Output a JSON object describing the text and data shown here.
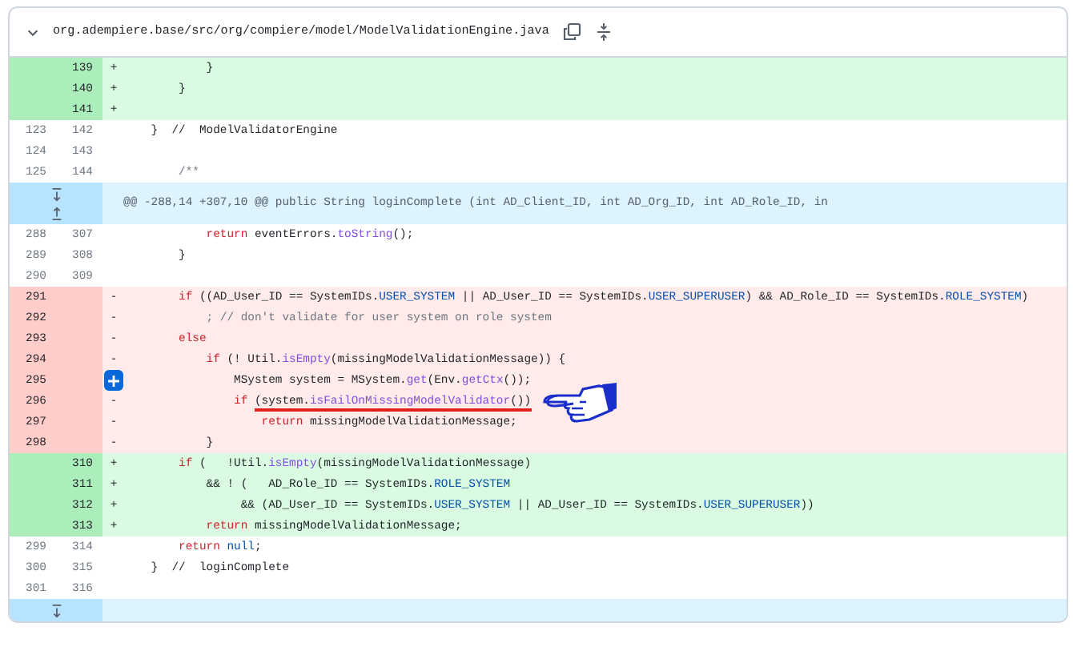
{
  "file": {
    "path": "org.adempiere.base/src/org/compiere/model/ModelValidationEngine.java",
    "expanded": true
  },
  "lines": [
    {
      "kind": "add",
      "new": "139",
      "marker": "+",
      "tokens": [
        {
          "kind": "plain",
          "t": "            }"
        }
      ]
    },
    {
      "kind": "add",
      "new": "140",
      "marker": "+",
      "tokens": [
        {
          "kind": "plain",
          "t": "        }"
        }
      ]
    },
    {
      "kind": "add",
      "new": "141",
      "marker": "+"
    },
    {
      "kind": "context",
      "old": "123",
      "new": "142",
      "tokens": [
        {
          "kind": "plain",
          "t": "    }  //  ModelValidatorEngine"
        }
      ]
    },
    {
      "kind": "context",
      "old": "124",
      "new": "143"
    },
    {
      "kind": "context",
      "old": "125",
      "new": "144",
      "tokens": [
        {
          "kind": "comment",
          "t": "        /**"
        }
      ]
    },
    {
      "kind": "hunk",
      "expand_down": true,
      "expand_up": true,
      "text": "@@ -288,14 +307,10 @@ public String loginComplete (int AD_Client_ID, int AD_Org_ID, int AD_Role_ID, in"
    },
    {
      "kind": "context",
      "old": "288",
      "new": "307",
      "tokens": [
        {
          "kind": "keyword",
          "t": "            return"
        },
        {
          "kind": "plain",
          "t": " eventErrors."
        },
        {
          "kind": "function",
          "t": "toString"
        },
        {
          "kind": "plain",
          "t": "();"
        }
      ]
    },
    {
      "kind": "context",
      "old": "289",
      "new": "308",
      "tokens": [
        {
          "kind": "plain",
          "t": "        }"
        }
      ]
    },
    {
      "kind": "context",
      "old": "290",
      "new": "309"
    },
    {
      "kind": "del",
      "old": "291",
      "marker": "-",
      "tokens": [
        {
          "kind": "keyword",
          "t": "        if"
        },
        {
          "kind": "plain",
          "t": " ((AD_User_ID == SystemIDs."
        },
        {
          "kind": "constant",
          "t": "USER_SYSTEM"
        },
        {
          "kind": "plain",
          "t": " || AD_User_ID == SystemIDs."
        },
        {
          "kind": "constant",
          "t": "USER_SUPERUSER"
        },
        {
          "kind": "plain",
          "t": ") && AD_Role_ID == SystemIDs."
        },
        {
          "kind": "constant",
          "t": "ROLE_SYSTEM"
        },
        {
          "kind": "plain",
          "t": ")"
        }
      ]
    },
    {
      "kind": "del",
      "old": "292",
      "marker": "-",
      "tokens": [
        {
          "kind": "comment",
          "t": "            ; // don't validate for user system on role system"
        }
      ]
    },
    {
      "kind": "del",
      "old": "293",
      "marker": "-",
      "tokens": [
        {
          "kind": "keyword",
          "t": "        else"
        }
      ]
    },
    {
      "kind": "del",
      "old": "294",
      "marker": "-",
      "tokens": [
        {
          "kind": "keyword",
          "t": "            if"
        },
        {
          "kind": "plain",
          "t": " (! Util."
        },
        {
          "kind": "function",
          "t": "isEmpty"
        },
        {
          "kind": "plain",
          "t": "(missingModelValidationMessage)) {"
        }
      ]
    },
    {
      "kind": "del",
      "old": "295",
      "comment_button": true,
      "tokens": [
        {
          "kind": "plain",
          "t": "                MSystem system = MSystem."
        },
        {
          "kind": "function",
          "t": "get"
        },
        {
          "kind": "plain",
          "t": "(Env."
        },
        {
          "kind": "function",
          "t": "getCtx"
        },
        {
          "kind": "plain",
          "t": "());"
        }
      ]
    },
    {
      "kind": "del",
      "old": "296",
      "marker": "-",
      "pointer": true,
      "tokens": [
        {
          "kind": "keyword",
          "t": "                if "
        },
        {
          "kind": "plain",
          "t": "(system.",
          "underlined": true
        },
        {
          "kind": "function",
          "t": "isFailOnMissingModelValidator",
          "underlined": true
        },
        {
          "kind": "plain",
          "t": "())",
          "underlined": true
        }
      ]
    },
    {
      "kind": "del",
      "old": "297",
      "marker": "-",
      "tokens": [
        {
          "kind": "keyword",
          "t": "                    return"
        },
        {
          "kind": "plain",
          "t": " missingModelValidationMessage;"
        }
      ]
    },
    {
      "kind": "del",
      "old": "298",
      "marker": "-",
      "tokens": [
        {
          "kind": "plain",
          "t": "            }"
        }
      ]
    },
    {
      "kind": "add",
      "new": "310",
      "marker": "+",
      "tokens": [
        {
          "kind": "keyword",
          "t": "        if"
        },
        {
          "kind": "plain",
          "t": " (   !Util."
        },
        {
          "kind": "function",
          "t": "isEmpty"
        },
        {
          "kind": "plain",
          "t": "(missingModelValidationMessage)"
        }
      ]
    },
    {
      "kind": "add",
      "new": "311",
      "marker": "+",
      "tokens": [
        {
          "kind": "plain",
          "t": "            && ! (   AD_Role_ID == SystemIDs."
        },
        {
          "kind": "constant",
          "t": "ROLE_SYSTEM"
        }
      ]
    },
    {
      "kind": "add",
      "new": "312",
      "marker": "+",
      "tokens": [
        {
          "kind": "plain",
          "t": "                 && (AD_User_ID == SystemIDs."
        },
        {
          "kind": "constant",
          "t": "USER_SYSTEM"
        },
        {
          "kind": "plain",
          "t": " || AD_User_ID == SystemIDs."
        },
        {
          "kind": "constant",
          "t": "USER_SUPERUSER"
        },
        {
          "kind": "plain",
          "t": "))"
        }
      ]
    },
    {
      "kind": "add",
      "new": "313",
      "marker": "+",
      "tokens": [
        {
          "kind": "keyword",
          "t": "            return"
        },
        {
          "kind": "plain",
          "t": " missingModelValidationMessage;"
        }
      ]
    },
    {
      "kind": "context",
      "old": "299",
      "new": "314",
      "tokens": [
        {
          "kind": "keyword",
          "t": "        return "
        },
        {
          "kind": "constant",
          "t": "null"
        },
        {
          "kind": "plain",
          "t": ";"
        }
      ]
    },
    {
      "kind": "context",
      "old": "300",
      "new": "315",
      "tokens": [
        {
          "kind": "plain",
          "t": "    }  //  loginComplete"
        }
      ]
    },
    {
      "kind": "context",
      "old": "301",
      "new": "316"
    },
    {
      "kind": "hunk",
      "expand_down": true
    }
  ]
}
